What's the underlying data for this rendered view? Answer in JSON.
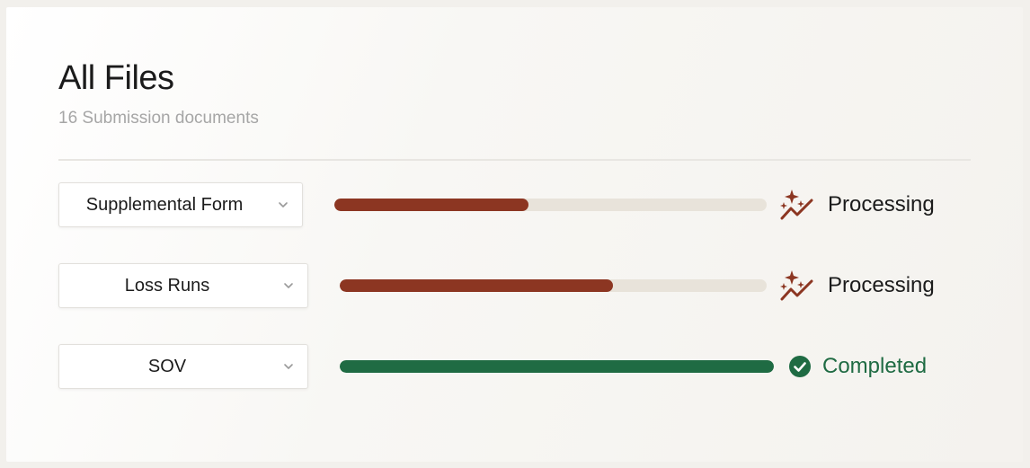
{
  "header": {
    "title": "All Files",
    "subtitle": "16 Submission documents"
  },
  "colors": {
    "processing": "#8c3622",
    "completed": "#1f6b43",
    "track": "#e8e3da"
  },
  "files": [
    {
      "type": "Supplemental Form",
      "progress": 0.45,
      "status": "Processing",
      "status_icon": "sparkle-trend-icon"
    },
    {
      "type": "Loss Runs",
      "progress": 0.64,
      "status": "Processing",
      "status_icon": "sparkle-trend-icon"
    },
    {
      "type": "SOV",
      "progress": 1.0,
      "status": "Completed",
      "status_icon": "check-circle-icon"
    }
  ]
}
